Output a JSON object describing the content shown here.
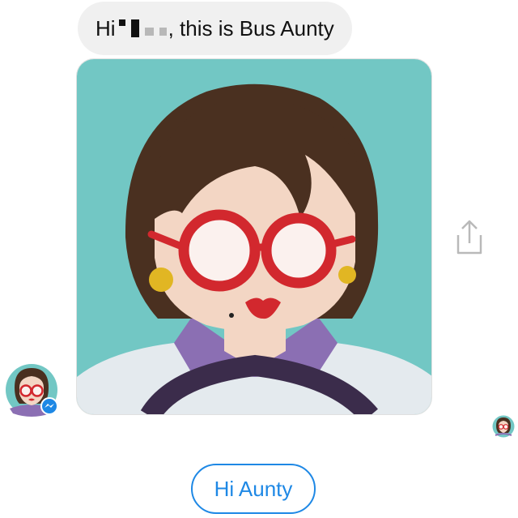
{
  "message": {
    "greeting_prefix": "Hi ",
    "greeting_suffix": ", this is Bus Aunty"
  },
  "quick_reply": {
    "label": "Hi Aunty"
  },
  "colors": {
    "bubble_bg": "#f0f0f0",
    "card_bg": "#72c7c4",
    "hair": "#4a3020",
    "skin": "#f3d6c4",
    "glasses": "#d2282e",
    "collar": "#8b6fb3",
    "steering_wheel": "#3b2c4b",
    "accent_blue": "#1e88e5"
  },
  "icons": {
    "share": "share-icon",
    "messenger_badge": "messenger-badge-icon"
  }
}
